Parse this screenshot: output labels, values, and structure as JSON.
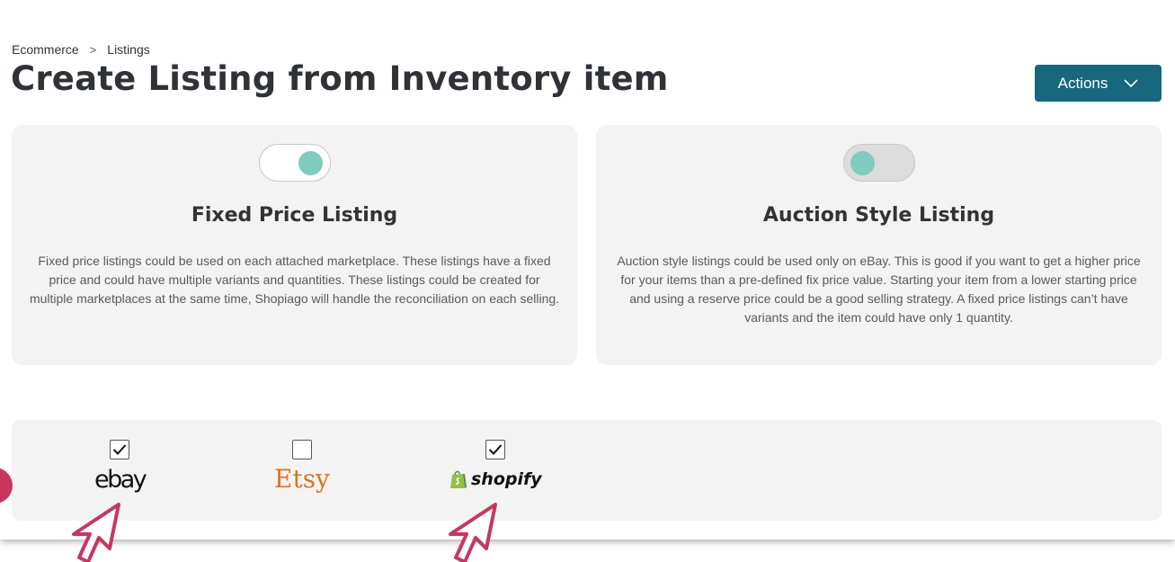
{
  "breadcrumb": {
    "items": [
      "Ecommerce",
      "Listings"
    ],
    "separator": ">"
  },
  "page": {
    "title": "Create Listing from Inventory item"
  },
  "actions": {
    "label": "Actions",
    "icon": "chevron-down-icon",
    "color": "#17677f"
  },
  "cards": {
    "fixed": {
      "title": "Fixed Price Listing",
      "toggle_on": true,
      "description": "Fixed price listings could be used on each attached marketplace. These listings have a fixed price and could have multiple variants and quantities. These listings could be created for multiple marketplaces at the same time, Shopiago will handle the reconciliation on each selling."
    },
    "auction": {
      "title": "Auction Style Listing",
      "toggle_on": false,
      "description": "Auction style listings could be used only on eBay. This is good if you want to get a higher price for your items than a pre-defined fix price value. Starting your item from a lower starting price and using a reserve price could be a good selling strategy. A fixed price listings can’t have variants and the item could have only 1 quantity."
    }
  },
  "toggle_color": "#7fcbbd",
  "marketplaces": [
    {
      "name": "ebay",
      "checked": true
    },
    {
      "name": "Etsy",
      "checked": false,
      "color": "#e4701e"
    },
    {
      "name": "shopify",
      "checked": true,
      "color": "#95bf47"
    }
  ],
  "annotation_color": "#c8365f"
}
